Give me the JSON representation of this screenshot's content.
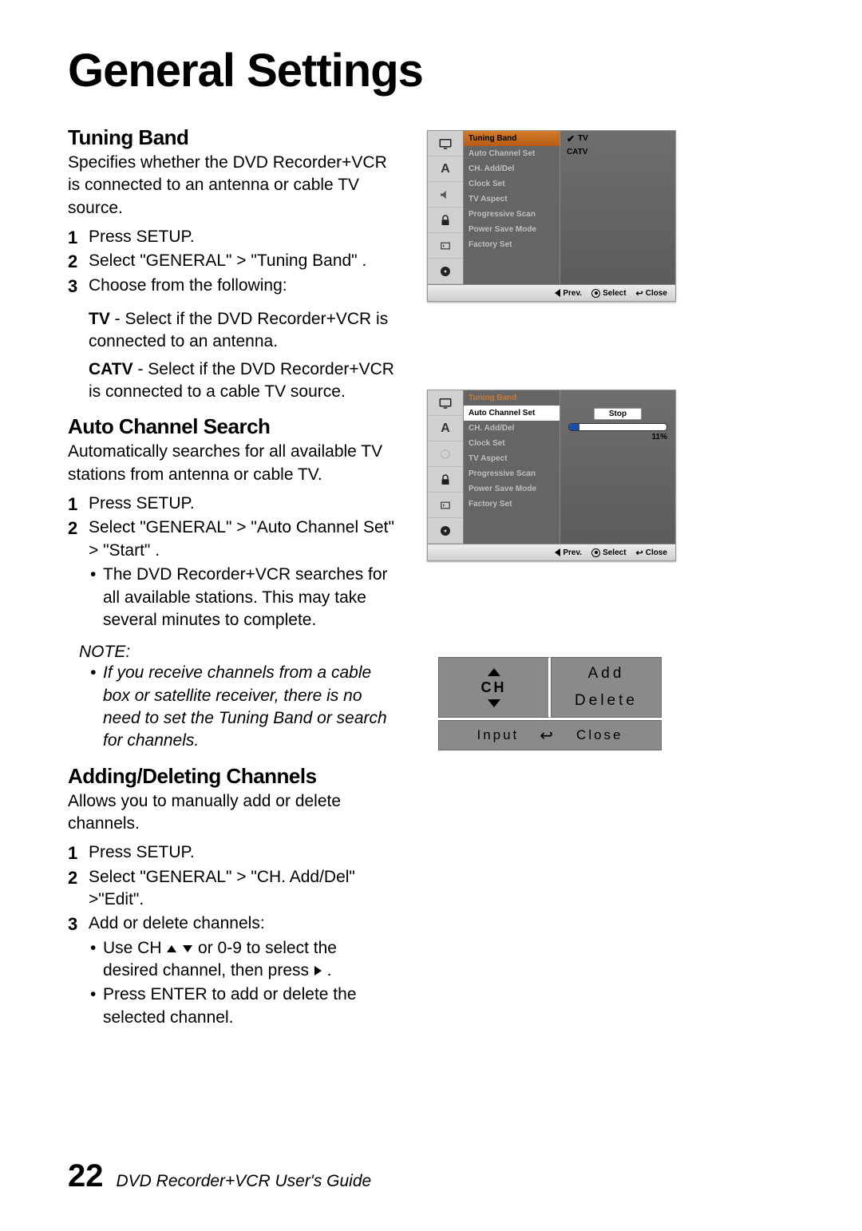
{
  "page_title": "General Settings",
  "sections": {
    "tuning": {
      "heading": "Tuning Band",
      "desc": "Specifies whether the DVD Recorder+VCR is connected to an antenna or cable TV source.",
      "steps": [
        "Press SETUP.",
        "Select \"GENERAL\" > \"Tuning Band\" .",
        "Choose from the following:"
      ],
      "opt_tv_label": "TV",
      "opt_tv_text": " - Select if the DVD Recorder+VCR is connected to an antenna.",
      "opt_catv_label": "CATV",
      "opt_catv_text": " - Select if the DVD Recorder+VCR is connected to a cable TV source."
    },
    "autosearch": {
      "heading": "Auto Channel Search",
      "desc": "Automatically searches for all available TV stations from antenna or cable TV.",
      "steps": [
        "Press SETUP.",
        "Select \"GENERAL\" > \"Auto Channel Set\" > \"Start\" ."
      ],
      "bullet": "The DVD Recorder+VCR searches for all available stations. This may take several minutes to complete.",
      "note_label": "NOTE:",
      "note_bullet": "If you receive channels from a cable box or satellite receiver, there is no need to set the Tuning Band or search for channels."
    },
    "adddel": {
      "heading": "Adding/Deleting Channels",
      "desc": "Allows you to manually add or delete channels.",
      "steps": [
        "Press SETUP.",
        "Select \"GENERAL\" > \"CH. Add/Del\" >\"Edit\".",
        "Add or delete channels:"
      ],
      "b1a": "Use CH ",
      "b1b": " or 0-9 to select the desired channel, then press ",
      "b1c": " .",
      "b2": "Press ENTER to add or delete the selected channel."
    }
  },
  "osd_menu_items": [
    "Tuning Band",
    "Auto Channel Set",
    "CH. Add/Del",
    "Clock Set",
    "TV Aspect",
    "Progressive Scan",
    "Power Save Mode",
    "Factory Set"
  ],
  "osd1": {
    "right_opts": [
      "TV",
      "CATV"
    ],
    "selected": "TV"
  },
  "osd2": {
    "highlight": "Auto Channel Set",
    "stop_label": "Stop",
    "progress_pct": "11%"
  },
  "osd_footer": {
    "prev": "Prev.",
    "select": "Select",
    "close": "Close"
  },
  "osd3": {
    "ch_label": "CH",
    "add": "Add",
    "delete": "Delete",
    "input": "Input",
    "close": "Close"
  },
  "footer": {
    "page": "22",
    "guide": "DVD Recorder+VCR User's Guide"
  }
}
